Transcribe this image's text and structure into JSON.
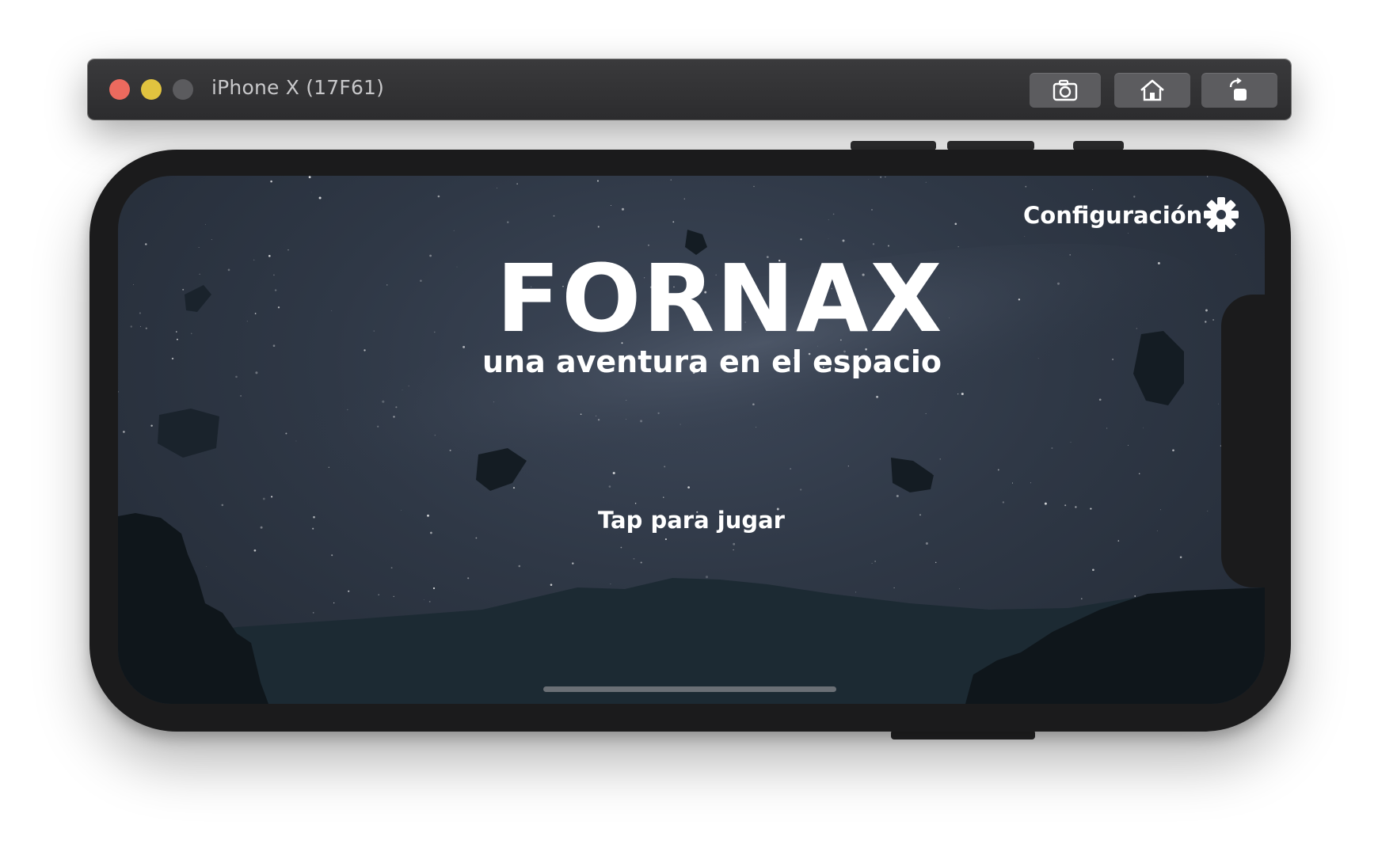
{
  "window": {
    "title": "iPhone X (17F61)",
    "controls": [
      "close",
      "minimize",
      "zoom"
    ],
    "toolbar_buttons": [
      {
        "name": "screenshot",
        "icon": "camera-icon"
      },
      {
        "name": "home",
        "icon": "home-icon"
      },
      {
        "name": "rotate",
        "icon": "rotate-icon"
      }
    ]
  },
  "game": {
    "title": "FORNAX",
    "subtitle": "una aventura en el espacio",
    "settings_label": "Configuración",
    "settings_icon": "gear-icon",
    "tap_prompt": "Tap para jugar"
  },
  "colors": {
    "close": "#ec6a5e",
    "minimize": "#e1c33f",
    "zoom": "#5b5b5e",
    "sky": "#2f3846",
    "ground": "#1c2a33",
    "rocks": "#131a20"
  }
}
